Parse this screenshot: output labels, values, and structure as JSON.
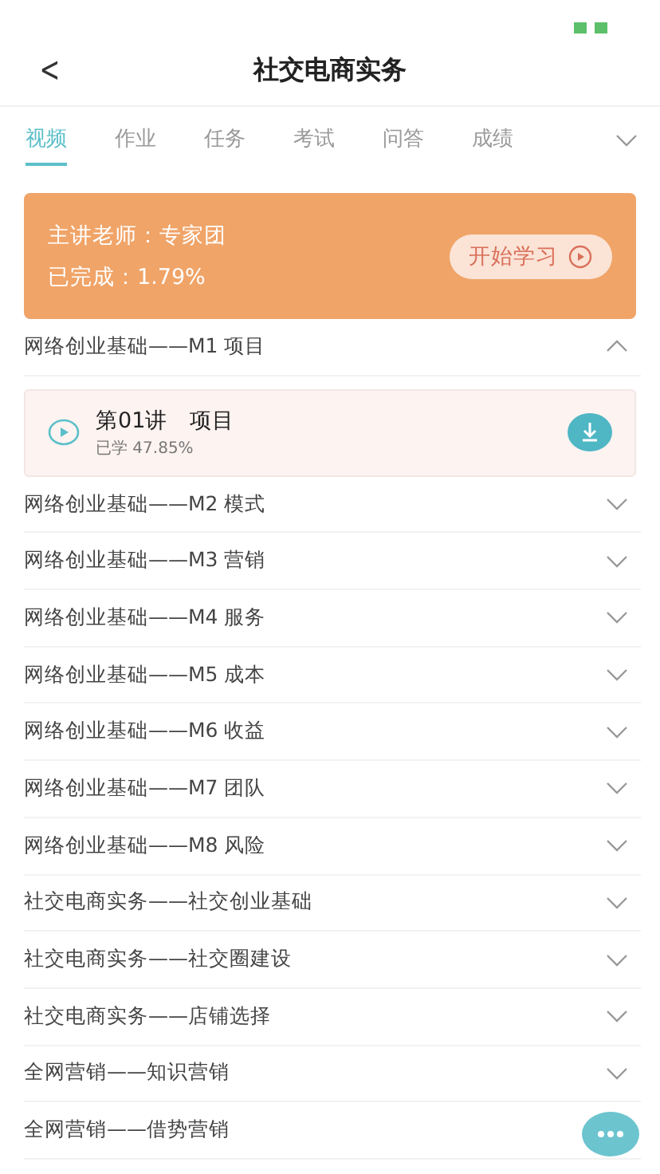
{
  "header": {
    "back": "<",
    "title": "社交电商实务"
  },
  "tabs": [
    {
      "label": "视频",
      "selected": true
    },
    {
      "label": "作业",
      "selected": false
    },
    {
      "label": "任务",
      "selected": false
    },
    {
      "label": "考试",
      "selected": false
    },
    {
      "label": "问答",
      "selected": false
    },
    {
      "label": "成绩",
      "selected": false
    }
  ],
  "course_card": {
    "teacher": "主讲老师：专家团",
    "progress": "已完成：1.79%",
    "button": "开始学习"
  },
  "sections": [
    {
      "title": "网络创业基础——M1 项目",
      "expanded": true,
      "lessons": [
        {
          "title": "第01讲　项目",
          "studied": "已学 47.85%"
        }
      ]
    },
    {
      "title": "网络创业基础——M2 模式",
      "expanded": false
    },
    {
      "title": "网络创业基础——M3 营销",
      "expanded": false
    },
    {
      "title": "网络创业基础——M4 服务",
      "expanded": false
    },
    {
      "title": "网络创业基础——M5 成本",
      "expanded": false
    },
    {
      "title": "网络创业基础——M6 收益",
      "expanded": false
    },
    {
      "title": "网络创业基础——M7 团队",
      "expanded": false
    },
    {
      "title": "网络创业基础——M8 风险",
      "expanded": false
    },
    {
      "title": "社交电商实务——社交创业基础",
      "expanded": false
    },
    {
      "title": "社交电商实务——社交圈建设",
      "expanded": false
    },
    {
      "title": "社交电商实务——店铺选择",
      "expanded": false
    },
    {
      "title": "全网营销——知识营销",
      "expanded": false
    },
    {
      "title": "全网营销——借势营销",
      "expanded": false
    }
  ]
}
